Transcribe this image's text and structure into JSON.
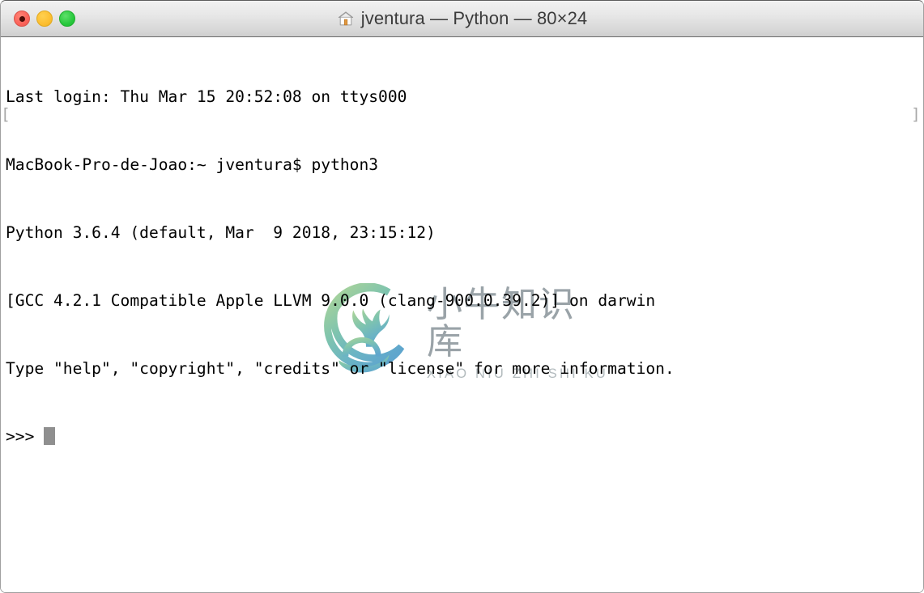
{
  "window": {
    "title": "jventura — Python — 80×24",
    "title_icon": "house-icon",
    "traffic_lights": [
      {
        "name": "close-button",
        "label": "Close",
        "color": "#fb6259"
      },
      {
        "name": "minimize-button",
        "label": "Minimize",
        "color": "#fcbe30"
      },
      {
        "name": "zoom-button",
        "label": "Zoom",
        "color": "#27c83c"
      }
    ]
  },
  "terminal": {
    "columns": 80,
    "rows": 24,
    "foreground_color": "#000000",
    "background_color": "#ffffff",
    "cursor_color": "#8f8f8f",
    "wrap_marker_color": "#a8a8a8",
    "wrap_marker_left": "[",
    "wrap_marker_right": "]",
    "lines": [
      "Last login: Thu Mar 15 20:52:08 on ttys000",
      "MacBook-Pro-de-Joao:~ jventura$ python3",
      "Python 3.6.4 (default, Mar  9 2018, 23:15:12)",
      "[GCC 4.2.1 Compatible Apple LLVM 9.0.0 (clang-900.0.39.2)] on darwin",
      "Type \"help\", \"copyright\", \"credits\" or \"license\" for more information.",
      ">>> "
    ],
    "prompt": ">>> "
  },
  "watermark": {
    "logo_name": "ox-in-circle-logo",
    "chinese": "小牛知识库",
    "pinyin": "XIAO NIU ZHI SHI KU",
    "gradient_start": "#9ccf8f",
    "gradient_end": "#61a8cf"
  }
}
